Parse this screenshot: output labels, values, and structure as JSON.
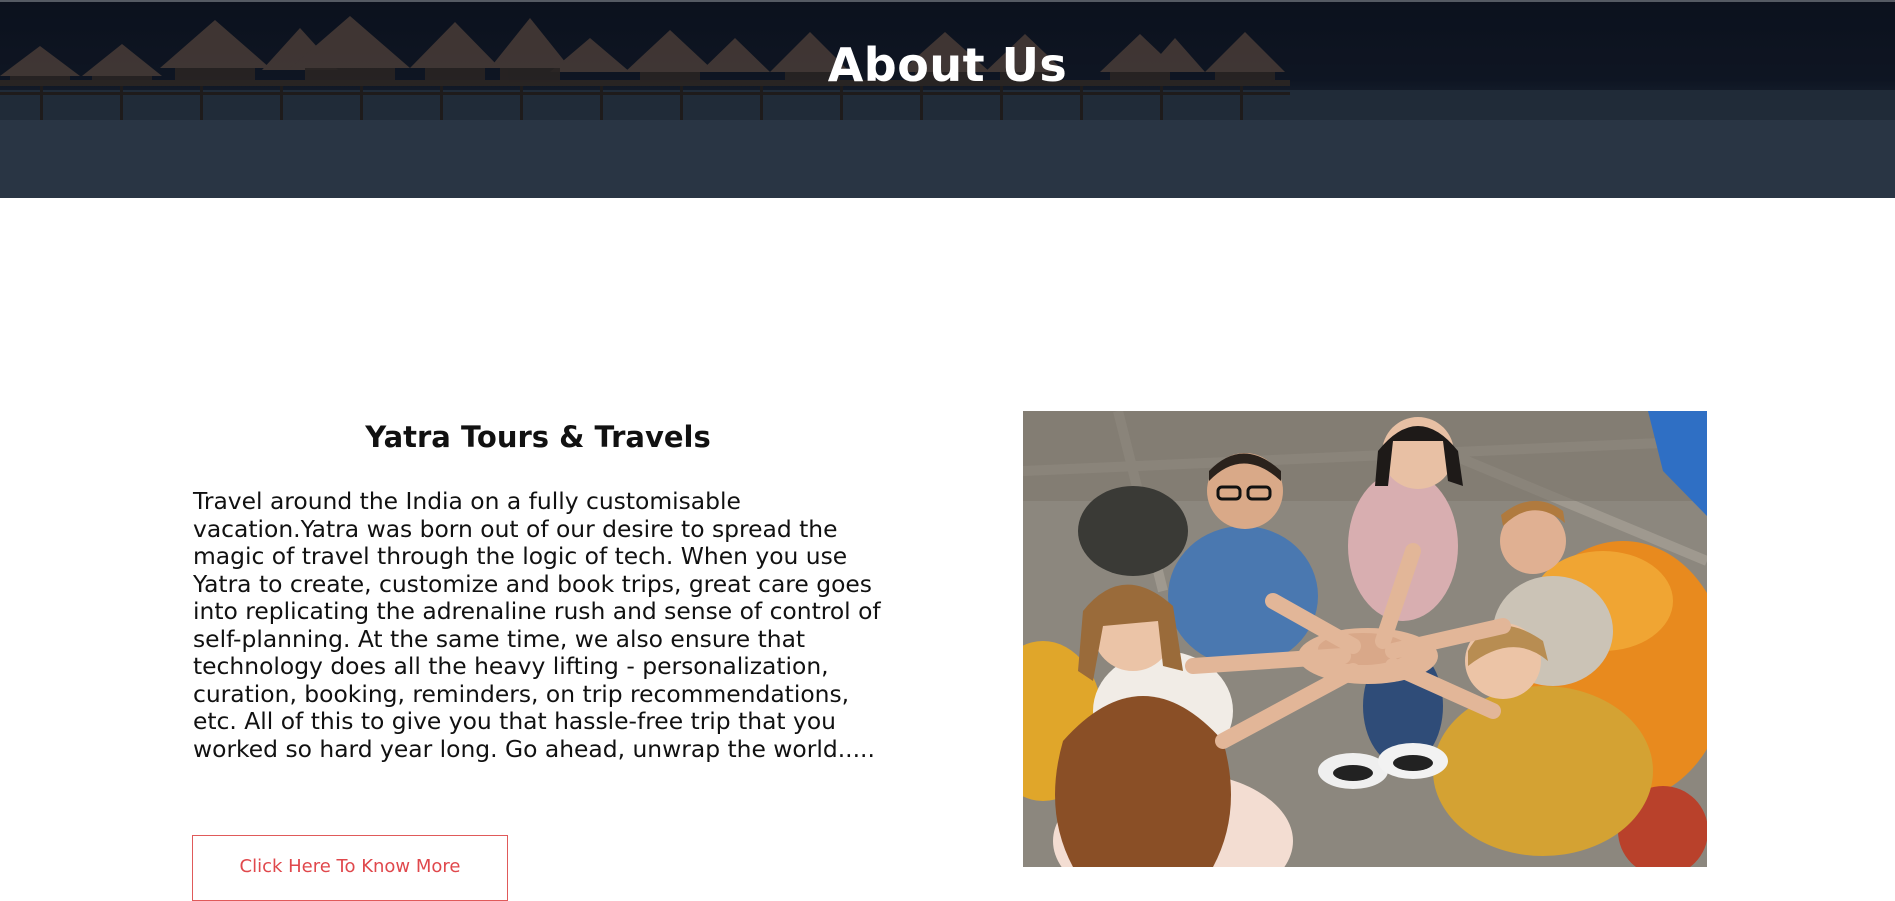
{
  "hero": {
    "title": "About Us"
  },
  "about": {
    "heading": "Yatra Tours & Travels",
    "paragraph": "Travel around the India on a fully customisable vacation.Yatra was born out of our desire to spread the magic of travel through the logic of tech. When you use Yatra to create, customize and book trips, great care goes into replicating the adrenaline rush and sense of control of self-planning. At the same time, we also ensure that technology does all the heavy lifting - personalization, curation, booking, reminders, on trip recommendations, etc. All of this to give you that hassle-free trip that you worked so hard year long. Go ahead, unwrap the world.....",
    "button_label": "Click Here To Know More"
  },
  "colors": {
    "button_accent": "#e0484c",
    "hero_overlay": "#0e1320"
  },
  "images": {
    "hero_background": "water-villas-photo",
    "team_photo": "group-hands-stack-photo"
  }
}
